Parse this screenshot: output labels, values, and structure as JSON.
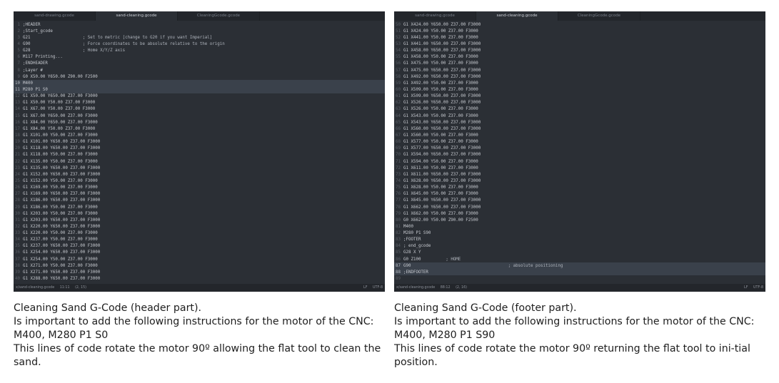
{
  "left": {
    "tabs": [
      "sand-drawing.gcode",
      "sand-cleaning.gcode",
      "CleaningGcode.gcode"
    ],
    "active_tab": 1,
    "highlight": [
      10,
      11
    ],
    "lines": [
      {
        "n": "1",
        "code": ";HEADER",
        "comment": ""
      },
      {
        "n": "2",
        "code": ";Start_gcode",
        "comment": ""
      },
      {
        "n": "3",
        "code": "G21                     ",
        "comment": "; Set to metric [change to G20 if you want Imperial]"
      },
      {
        "n": "4",
        "code": "G90                     ",
        "comment": "; Force coordinates to be absolute relative to the origin"
      },
      {
        "n": "5",
        "code": "G28                     ",
        "comment": "; Home X/Y/Z axis"
      },
      {
        "n": "6",
        "code": "M117 Printing...",
        "comment": ""
      },
      {
        "n": "7",
        "code": ";ENDHEADER",
        "comment": ""
      },
      {
        "n": "8",
        "code": ";Layer #",
        "comment": ""
      },
      {
        "n": "9",
        "code": "G0 X50.00 Y650.00 Z90.00 F2500",
        "comment": ""
      },
      {
        "n": "10",
        "code": "M400",
        "comment": ""
      },
      {
        "n": "11",
        "code": "M280 P1 S0",
        "comment": ""
      },
      {
        "n": "12",
        "code": "G1 X50.00 Y650.00 Z37.00 F3000",
        "comment": ""
      },
      {
        "n": "13",
        "code": "G1 X50.00 Y50.00 Z37.00 F3000",
        "comment": ""
      },
      {
        "n": "14",
        "code": "G1 X67.00 Y50.00 Z37.00 F3000",
        "comment": ""
      },
      {
        "n": "15",
        "code": "G1 X67.00 Y650.00 Z37.00 F3000",
        "comment": ""
      },
      {
        "n": "16",
        "code": "G1 X84.00 Y650.00 Z37.00 F3000",
        "comment": ""
      },
      {
        "n": "17",
        "code": "G1 X84.00 Y50.00 Z37.00 F3000",
        "comment": ""
      },
      {
        "n": "18",
        "code": "G1 X101.00 Y50.00 Z37.00 F3000",
        "comment": ""
      },
      {
        "n": "19",
        "code": "G1 X101.00 Y650.00 Z37.00 F3000",
        "comment": ""
      },
      {
        "n": "20",
        "code": "G1 X118.00 Y650.00 Z37.00 F3000",
        "comment": ""
      },
      {
        "n": "21",
        "code": "G1 X118.00 Y50.00 Z37.00 F3000",
        "comment": ""
      },
      {
        "n": "22",
        "code": "G1 X135.00 Y50.00 Z37.00 F3000",
        "comment": ""
      },
      {
        "n": "23",
        "code": "G1 X135.00 Y650.00 Z37.00 F3000",
        "comment": ""
      },
      {
        "n": "24",
        "code": "G1 X152.00 Y650.00 Z37.00 F3000",
        "comment": ""
      },
      {
        "n": "25",
        "code": "G1 X152.00 Y50.00 Z37.00 F3000",
        "comment": ""
      },
      {
        "n": "26",
        "code": "G1 X169.00 Y50.00 Z37.00 F3000",
        "comment": ""
      },
      {
        "n": "27",
        "code": "G1 X169.00 Y650.00 Z37.00 F3000",
        "comment": ""
      },
      {
        "n": "28",
        "code": "G1 X186.00 Y650.00 Z37.00 F3000",
        "comment": ""
      },
      {
        "n": "29",
        "code": "G1 X186.00 Y50.00 Z37.00 F3000",
        "comment": ""
      },
      {
        "n": "30",
        "code": "G1 X203.00 Y50.00 Z37.00 F3000",
        "comment": ""
      },
      {
        "n": "31",
        "code": "G1 X203.00 Y650.00 Z37.00 F3000",
        "comment": ""
      },
      {
        "n": "32",
        "code": "G1 X220.00 Y650.00 Z37.00 F3000",
        "comment": ""
      },
      {
        "n": "33",
        "code": "G1 X220.00 Y50.00 Z37.00 F3000",
        "comment": ""
      },
      {
        "n": "34",
        "code": "G1 X237.00 Y50.00 Z37.00 F3000",
        "comment": ""
      },
      {
        "n": "35",
        "code": "G1 X237.00 Y650.00 Z37.00 F3000",
        "comment": ""
      },
      {
        "n": "36",
        "code": "G1 X254.00 Y650.00 Z37.00 F3000",
        "comment": ""
      },
      {
        "n": "37",
        "code": "G1 X254.00 Y50.00 Z37.00 F3000",
        "comment": ""
      },
      {
        "n": "38",
        "code": "G1 X271.00 Y50.00 Z37.00 F3000",
        "comment": ""
      },
      {
        "n": "39",
        "code": "G1 X271.00 Y650.00 Z37.00 F3000",
        "comment": ""
      },
      {
        "n": "40",
        "code": "G1 X288.00 Y650.00 Z37.00 F3000",
        "comment": ""
      }
    ],
    "status": {
      "file": "x/sand-cleaning.gcode",
      "lines": "11:11",
      "cursor": "(2, 15)",
      "eol": "LF",
      "enc": "UTF-8"
    }
  },
  "right": {
    "tabs": [
      "sand-drawing.gcode",
      "sand-cleaning.gcode",
      "CleaningGcode.gcode"
    ],
    "active_tab": 1,
    "highlight": [
      87,
      88
    ],
    "lines": [
      {
        "n": "50",
        "code": "G1 X424.00 Y650.00 Z37.00 F3000",
        "comment": ""
      },
      {
        "n": "51",
        "code": "G1 X424.00 Y50.00 Z37.00 F3000",
        "comment": ""
      },
      {
        "n": "52",
        "code": "G1 X441.00 Y50.00 Z37.00 F3000",
        "comment": ""
      },
      {
        "n": "53",
        "code": "G1 X441.00 Y650.00 Z37.00 F3000",
        "comment": ""
      },
      {
        "n": "54",
        "code": "G1 X458.00 Y650.00 Z37.00 F3000",
        "comment": ""
      },
      {
        "n": "55",
        "code": "G1 X458.00 Y50.00 Z37.00 F3000",
        "comment": ""
      },
      {
        "n": "56",
        "code": "G1 X475.00 Y50.00 Z37.00 F3000",
        "comment": ""
      },
      {
        "n": "57",
        "code": "G1 X475.00 Y650.00 Z37.00 F3000",
        "comment": ""
      },
      {
        "n": "58",
        "code": "G1 X492.00 Y650.00 Z37.00 F3000",
        "comment": ""
      },
      {
        "n": "59",
        "code": "G1 X492.00 Y50.00 Z37.00 F3000",
        "comment": ""
      },
      {
        "n": "60",
        "code": "G1 X509.00 Y50.00 Z37.00 F3000",
        "comment": ""
      },
      {
        "n": "61",
        "code": "G1 X509.00 Y650.00 Z37.00 F3000",
        "comment": ""
      },
      {
        "n": "62",
        "code": "G1 X526.00 Y650.00 Z37.00 F3000",
        "comment": ""
      },
      {
        "n": "63",
        "code": "G1 X526.00 Y50.00 Z37.00 F3000",
        "comment": ""
      },
      {
        "n": "64",
        "code": "G1 X543.00 Y50.00 Z37.00 F3000",
        "comment": ""
      },
      {
        "n": "65",
        "code": "G1 X543.00 Y650.00 Z37.00 F3000",
        "comment": ""
      },
      {
        "n": "66",
        "code": "G1 X560.00 Y650.00 Z37.00 F3000",
        "comment": ""
      },
      {
        "n": "67",
        "code": "G1 X560.00 Y50.00 Z37.00 F3000",
        "comment": ""
      },
      {
        "n": "68",
        "code": "G1 X577.00 Y50.00 Z37.00 F3000",
        "comment": ""
      },
      {
        "n": "69",
        "code": "G1 X577.00 Y650.00 Z37.00 F3000",
        "comment": ""
      },
      {
        "n": "70",
        "code": "G1 X594.00 Y650.00 Z37.00 F3000",
        "comment": ""
      },
      {
        "n": "71",
        "code": "G1 X594.00 Y50.00 Z37.00 F3000",
        "comment": ""
      },
      {
        "n": "72",
        "code": "G1 X611.00 Y50.00 Z37.00 F3000",
        "comment": ""
      },
      {
        "n": "73",
        "code": "G1 X611.00 Y650.00 Z37.00 F3000",
        "comment": ""
      },
      {
        "n": "74",
        "code": "G1 X628.00 Y650.00 Z37.00 F3000",
        "comment": ""
      },
      {
        "n": "75",
        "code": "G1 X628.00 Y50.00 Z37.00 F3000",
        "comment": ""
      },
      {
        "n": "76",
        "code": "G1 X645.00 Y50.00 Z37.00 F3000",
        "comment": ""
      },
      {
        "n": "77",
        "code": "G1 X645.00 Y650.00 Z37.00 F3000",
        "comment": ""
      },
      {
        "n": "78",
        "code": "G1 X662.00 Y650.00 Z37.00 F3000",
        "comment": ""
      },
      {
        "n": "79",
        "code": "G1 X662.00 Y50.00 Z37.00 F3000",
        "comment": ""
      },
      {
        "n": "80",
        "code": "G0 X662.00 Y50.00 Z90.00 F2500",
        "comment": ""
      },
      {
        "n": "81",
        "code": "M400",
        "comment": ""
      },
      {
        "n": "82",
        "code": "M280 P1 S90",
        "comment": ""
      },
      {
        "n": "83",
        "code": ";FOOTER",
        "comment": ""
      },
      {
        "n": "84",
        "code": "; end_gcode",
        "comment": ""
      },
      {
        "n": "85",
        "code": "G28 X Y",
        "comment": ""
      },
      {
        "n": "86",
        "code": "G0 Z100          ",
        "comment": "; HOME"
      },
      {
        "n": "87",
        "code": "G90                                       ",
        "comment": "; absolute positioning"
      },
      {
        "n": "88",
        "code": ";ENDFOOTER",
        "comment": ""
      },
      {
        "n": "89",
        "code": "",
        "comment": ""
      }
    ],
    "status": {
      "file": "x/sand-cleaning.gcode",
      "lines": "88:12",
      "cursor": "(2, 16)",
      "eol": "LF",
      "enc": "UTF-8"
    }
  },
  "captions": {
    "left": [
      "Cleaning Sand G-Code (header part).",
      "Is important to add the following instructions for the motor of the CNC: M400, M280 P1 S0",
      "This lines of code rotate the motor 90º allowing the flat tool to clean the sand."
    ],
    "right": [
      "Cleaning Sand G-Code (footer part).",
      "Is important to add the following instructions for the motor of the CNC: M400, M280 P1 S90",
      "This lines of code rotate the motor 90º returning the flat tool to ini-tial position."
    ]
  }
}
